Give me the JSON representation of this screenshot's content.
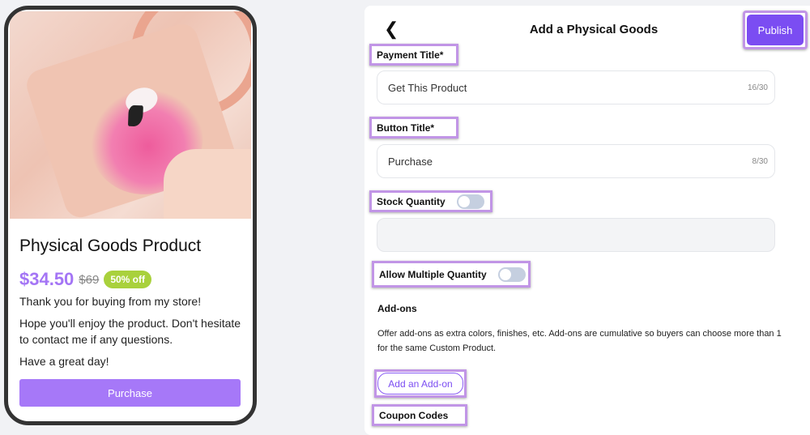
{
  "preview": {
    "product_title": "Physical Goods Product",
    "price": "$34.50",
    "original_price": "$69",
    "discount_badge": "50% off",
    "description": [
      "Thank you for buying from my store!",
      "Hope you'll enjoy the product. Don't hesitate to contact me if any questions.",
      "Have a great day!"
    ],
    "button_label": "Purchase"
  },
  "editor": {
    "title": "Add a Physical Goods",
    "back_icon": "chevron-left-icon",
    "publish_label": "Publish",
    "payment_title": {
      "label": "Payment Title*",
      "value": "Get This Product",
      "count": "16/30"
    },
    "button_title": {
      "label": "Button Title*",
      "value": "Purchase",
      "count": "8/30"
    },
    "stock_quantity": {
      "label": "Stock Quantity",
      "enabled": false,
      "value": ""
    },
    "allow_multiple": {
      "label": "Allow Multiple Quantity",
      "enabled": false
    },
    "addons": {
      "heading": "Add-ons",
      "description": "Offer add-ons as extra colors, finishes, etc. Add-ons are cumulative so buyers can choose more than 1 for the same Custom Product.",
      "button_label": "Add an Add-on"
    },
    "coupon_codes": {
      "label": "Coupon Codes"
    }
  },
  "colors": {
    "accent": "#7b4df2",
    "preview_button": "#a678f8",
    "badge": "#a9d13c",
    "highlight": "#c195e6"
  }
}
